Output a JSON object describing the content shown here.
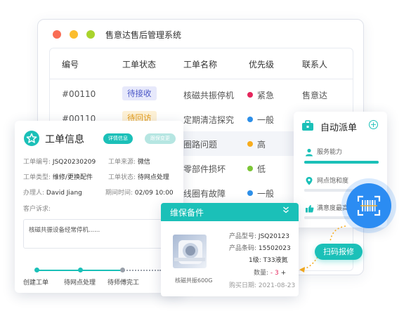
{
  "window": {
    "title": "售意达售后管理系统",
    "traffic_colors": [
      "#f96d55",
      "#fbbd2e",
      "#a9d42c"
    ]
  },
  "table": {
    "headers": [
      "编号",
      "工单状态",
      "工单名称",
      "优先级",
      "联系人"
    ],
    "rows": [
      {
        "id": "#00110",
        "status": "待接收",
        "name": "核磁共振停机",
        "priority": "紧急",
        "priority_color": "#e5265c",
        "contact": "售意达"
      },
      {
        "id": "#00110",
        "status": "待回访",
        "name": "定期清洁探究",
        "priority": "一般",
        "priority_color": "#2d8fe8",
        "contact": ""
      },
      {
        "id": "",
        "status": "",
        "name": "圈路问题",
        "priority": "高",
        "priority_color": "#f7ac1d",
        "contact": ""
      },
      {
        "id": "",
        "status": "",
        "name": "零部件损坏",
        "priority": "低",
        "priority_color": "#7cc637",
        "contact": ""
      },
      {
        "id": "",
        "status": "",
        "name": "线圈有故障",
        "priority": "一般",
        "priority_color": "#2d8fe8",
        "contact": ""
      }
    ]
  },
  "work_order": {
    "title": "工单信息",
    "tab_detail": "详情信息",
    "tab_change": "跟保变更",
    "fields": {
      "order_no_label": "工单编号:",
      "order_no": "JSQ20230209",
      "source_label": "工单来源:",
      "source": "微信",
      "type_label": "工单类型:",
      "type": "维修/更换配件",
      "state_label": "工单状态:",
      "state": "待网点处理",
      "handler_label": "办理人:",
      "handler": "David Jiang",
      "deadline_label": "期间时间:",
      "deadline": "02/09  10:00",
      "request_label": "客户诉求:"
    },
    "request_text": "核磁共振设备经常停机......",
    "steps": [
      "创建工单",
      "待网点处理",
      "待师傅完工"
    ],
    "accent": "#1bc0b8"
  },
  "dispatch": {
    "title": "自动派单",
    "items": [
      {
        "label": "服务能力",
        "fill": 1.0
      },
      {
        "label": "网点饱和度",
        "fill": 0.45
      },
      {
        "label": "满意度最高",
        "fill": 0.45
      }
    ]
  },
  "parts": {
    "title": "维保备件",
    "image_caption": "核磁共振600G",
    "model_label": "产品型号:",
    "model": "JSQ20123",
    "code_label": "产品条码:",
    "code": "15502023",
    "level": "1级: T33液氮",
    "qty_label": "数量:",
    "qty_minus": "-",
    "qty": "3",
    "qty_plus": "+",
    "date_label": "购买日期:",
    "date": "2021-08-23"
  },
  "scan": {
    "button_label": "扫码报修",
    "accent": "#2b8cf2"
  }
}
